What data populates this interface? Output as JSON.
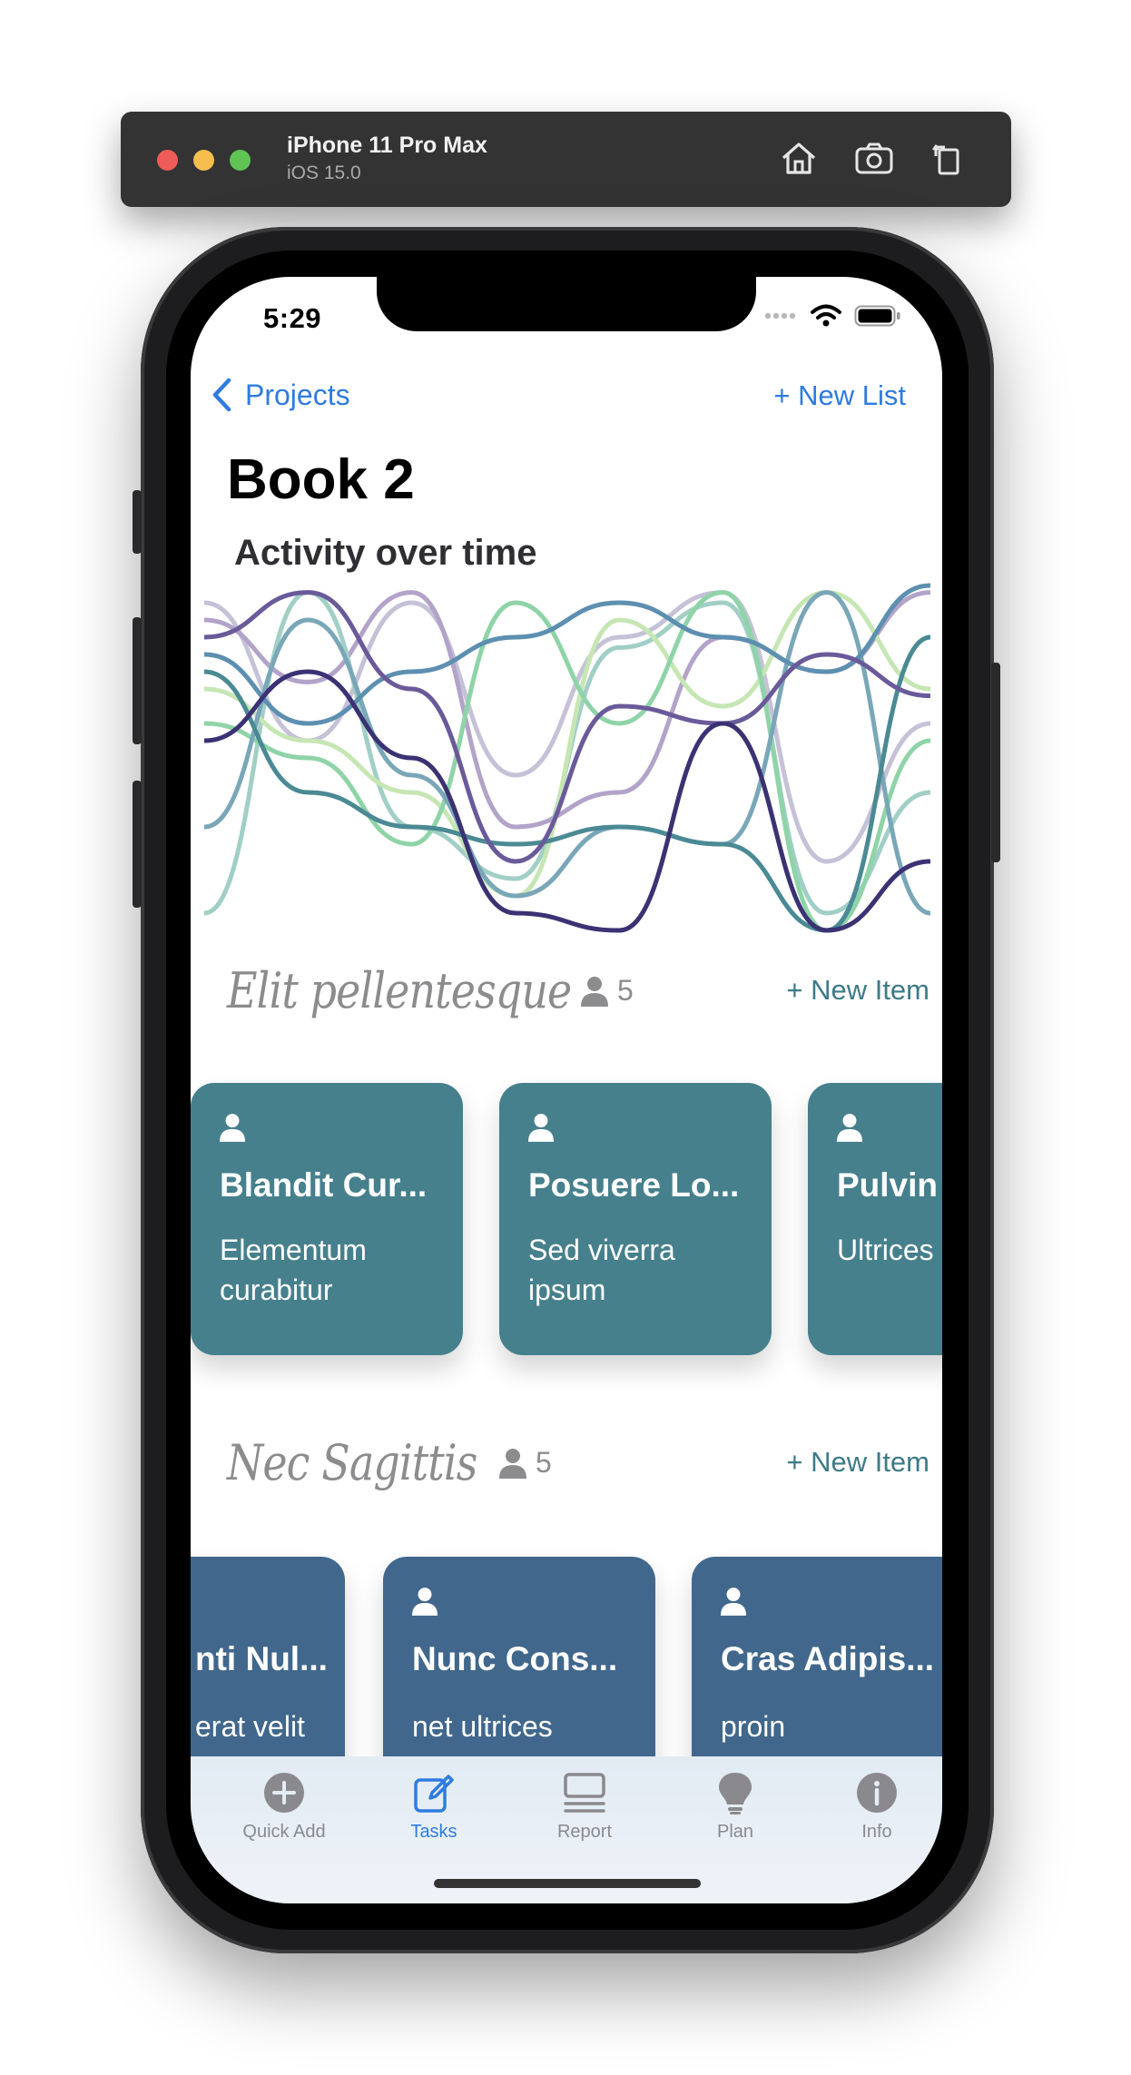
{
  "simulator": {
    "device_name": "iPhone 11 Pro Max",
    "os_version": "iOS 15.0",
    "colors": {
      "close": "#ed5c57",
      "minimize": "#f6be4f",
      "zoom": "#5fc454"
    },
    "buttons": [
      "home-icon",
      "screenshot-icon",
      "rotate-icon"
    ]
  },
  "status_bar": {
    "time": "5:29",
    "icons": [
      "signal-icon",
      "wifi-icon",
      "battery-icon"
    ]
  },
  "nav": {
    "back_label": "Projects",
    "right_action": "+ New List"
  },
  "page": {
    "title": "Book 2"
  },
  "chart": {
    "title": "Activity over time"
  },
  "chart_data": {
    "type": "line",
    "title": "Activity over time",
    "xlabel": "",
    "ylabel": "",
    "grid": false,
    "legend": "none",
    "x": [
      0,
      1,
      2,
      3,
      4,
      5,
      6,
      7
    ],
    "ylim": [
      0,
      1
    ],
    "series": [
      {
        "color": "#c5c2d8",
        "values": [
          0.95,
          0.55,
          0.95,
          0.45,
          0.85,
          0.98,
          0.2,
          0.6
        ]
      },
      {
        "color": "#b3a3c9",
        "values": [
          0.9,
          0.72,
          0.98,
          0.3,
          0.4,
          0.85,
          0.75,
          0.98
        ]
      },
      {
        "color": "#a1cfc6",
        "values": [
          0.05,
          0.98,
          0.3,
          0.15,
          0.82,
          0.95,
          0.05,
          0.4
        ]
      },
      {
        "color": "#c6e6b4",
        "values": [
          0.7,
          0.55,
          0.4,
          0.1,
          0.9,
          0.65,
          0.98,
          0.7
        ]
      },
      {
        "color": "#8fd4a8",
        "values": [
          0.6,
          0.5,
          0.25,
          0.95,
          0.6,
          0.98,
          0.0,
          0.55
        ]
      },
      {
        "color": "#7aa7b8",
        "values": [
          0.3,
          0.9,
          0.45,
          0.1,
          0.3,
          0.25,
          0.98,
          0.05
        ]
      },
      {
        "color": "#5d8fb0",
        "values": [
          0.8,
          0.6,
          0.75,
          0.85,
          0.95,
          0.85,
          0.75,
          1.0
        ]
      },
      {
        "color": "#4b8a94",
        "values": [
          0.75,
          0.4,
          0.3,
          0.25,
          0.3,
          0.25,
          0.0,
          0.85
        ]
      },
      {
        "color": "#6a5a9a",
        "values": [
          0.85,
          0.98,
          0.7,
          0.2,
          0.65,
          0.6,
          0.8,
          0.68
        ]
      },
      {
        "color": "#3b3273",
        "values": [
          0.55,
          0.75,
          0.5,
          0.05,
          0.0,
          0.6,
          0.0,
          0.2
        ]
      }
    ]
  },
  "sections": [
    {
      "title": "Elit pellentesque",
      "count": "5",
      "new_item": "+ New Item",
      "color": "#46808c",
      "cards": [
        {
          "title": "Blandit Cur...",
          "subtitle": "Elementum curabitur"
        },
        {
          "title": "Posuere Lo...",
          "subtitle": "Sed viverra ipsum"
        },
        {
          "title": "Pulvin",
          "subtitle": "Ultrices"
        }
      ]
    },
    {
      "title": "Nec Sagittis",
      "count": "5",
      "new_item": "+ New Item",
      "color": "#41678c",
      "cards": [
        {
          "title": "nti Nul...",
          "subtitle": "erat velit"
        },
        {
          "title": "Nunc Cons...",
          "subtitle": "net ultrices"
        },
        {
          "title": "Cras Adipis...",
          "subtitle": "proin"
        }
      ]
    }
  ],
  "tabs": [
    {
      "label": "Quick Add",
      "icon": "plus-circle-icon",
      "active": false
    },
    {
      "label": "Tasks",
      "icon": "edit-icon",
      "active": true
    },
    {
      "label": "Report",
      "icon": "report-icon",
      "active": false
    },
    {
      "label": "Plan",
      "icon": "lightbulb-icon",
      "active": false
    },
    {
      "label": "Info",
      "icon": "info-icon",
      "active": false
    }
  ],
  "accent": "#2f7be0"
}
